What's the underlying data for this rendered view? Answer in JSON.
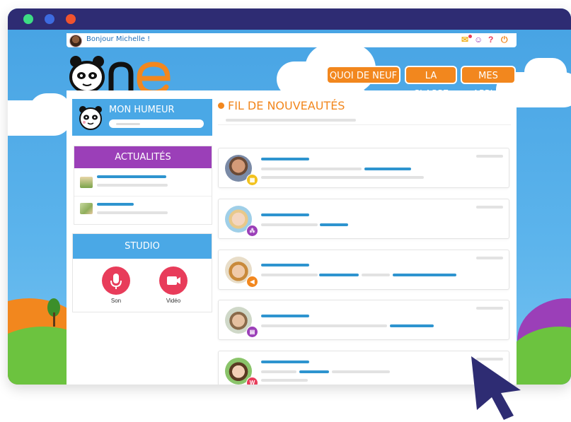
{
  "window": {
    "dot_colors": [
      "#3ddc84",
      "#3d6be0",
      "#f0532e"
    ]
  },
  "topbar": {
    "greeting": "Bonjour Michelle !",
    "icons": [
      "mail-icon",
      "user-icon",
      "help-icon",
      "power-icon"
    ]
  },
  "logo": {
    "text": "ONE"
  },
  "nav": [
    {
      "label": "QUOI DE NEUF ?"
    },
    {
      "label": "LA CLASSE"
    },
    {
      "label": "MES APPLIS"
    }
  ],
  "mood": {
    "title": "MON HUMEUR"
  },
  "news": {
    "title": "ACTUALITÉS"
  },
  "studio": {
    "title": "STUDIO",
    "son_label": "Son",
    "video_label": "Vidéo"
  },
  "feed": {
    "title": "FIL DE NOUVEAUTÉS",
    "badges": [
      "calendar-icon",
      "share-icon",
      "megaphone-icon",
      "document-icon",
      "wiki-icon"
    ]
  },
  "colors": {
    "accent_orange": "#f2871e",
    "blue": "#4aa8e6",
    "purple": "#9b3fb8",
    "red": "#e83c5a",
    "cursor": "#2e2c73"
  }
}
